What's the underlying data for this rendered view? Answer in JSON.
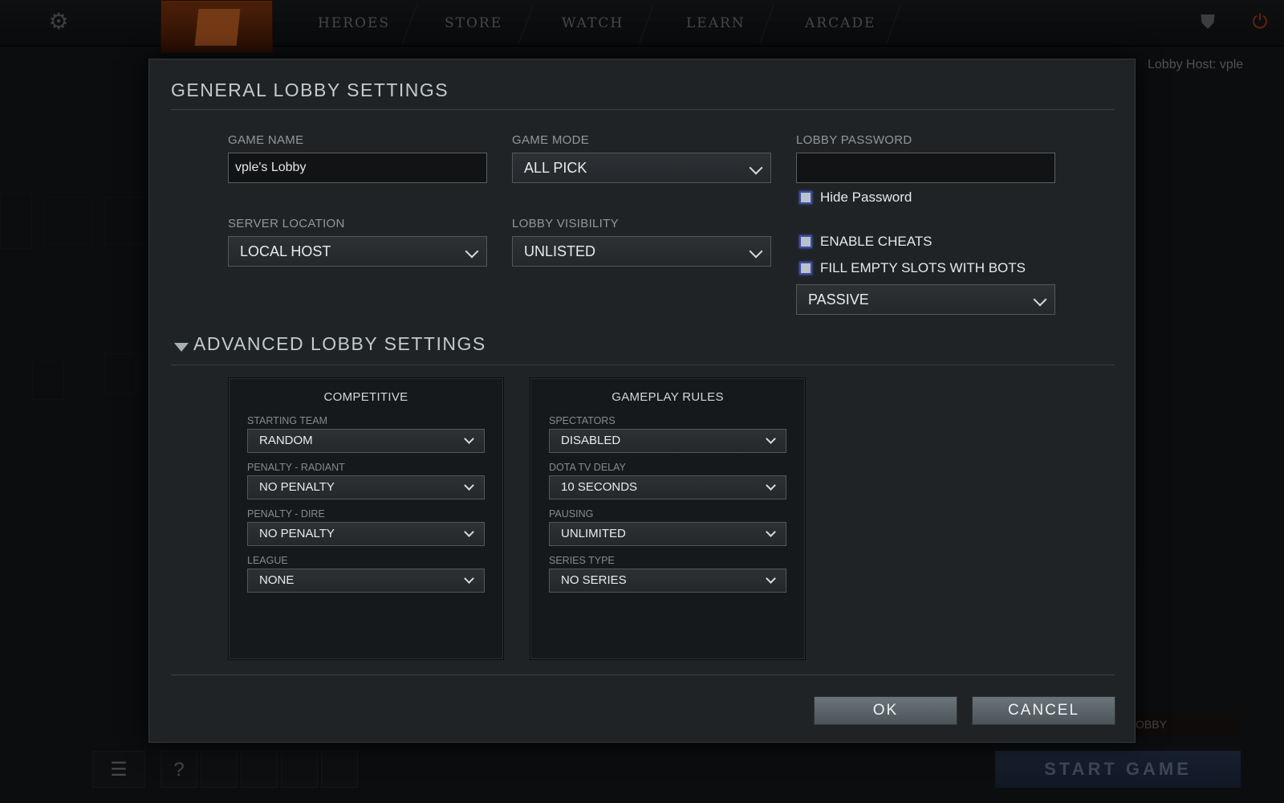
{
  "topbar": {
    "nav": [
      "HEROES",
      "STORE",
      "WATCH",
      "LEARN",
      "ARCADE"
    ]
  },
  "background": {
    "lobby_host": "Lobby Host: vple",
    "start_game": "START GAME",
    "leave_lobby": "OBBY",
    "help": "?"
  },
  "modal": {
    "general_title": "GENERAL LOBBY SETTINGS",
    "game_name": {
      "label": "GAME NAME",
      "value": "vple's Lobby"
    },
    "game_mode": {
      "label": "GAME MODE",
      "value": "ALL PICK"
    },
    "lobby_password": {
      "label": "LOBBY PASSWORD",
      "value": ""
    },
    "hide_password": "Hide Password",
    "server_location": {
      "label": "SERVER LOCATION",
      "value": "LOCAL HOST"
    },
    "lobby_visibility": {
      "label": "LOBBY VISIBILITY",
      "value": "UNLISTED"
    },
    "enable_cheats": "ENABLE CHEATS",
    "fill_bots": "FILL EMPTY SLOTS WITH BOTS",
    "bot_difficulty": "PASSIVE",
    "advanced_title": "ADVANCED LOBBY SETTINGS",
    "competitive": {
      "title": "COMPETITIVE",
      "fields": [
        {
          "label": "STARTING TEAM",
          "value": "RANDOM"
        },
        {
          "label": "PENALTY - RADIANT",
          "value": "NO PENALTY"
        },
        {
          "label": "PENALTY - DIRE",
          "value": "NO PENALTY"
        },
        {
          "label": "LEAGUE",
          "value": "NONE"
        }
      ]
    },
    "gameplay": {
      "title": "GAMEPLAY RULES",
      "fields": [
        {
          "label": "SPECTATORS",
          "value": "DISABLED"
        },
        {
          "label": "DOTA TV DELAY",
          "value": "10 SECONDS"
        },
        {
          "label": "PAUSING",
          "value": "UNLIMITED"
        },
        {
          "label": "SERIES TYPE",
          "value": "NO SERIES"
        }
      ]
    },
    "ok": "OK",
    "cancel": "CANCEL"
  }
}
